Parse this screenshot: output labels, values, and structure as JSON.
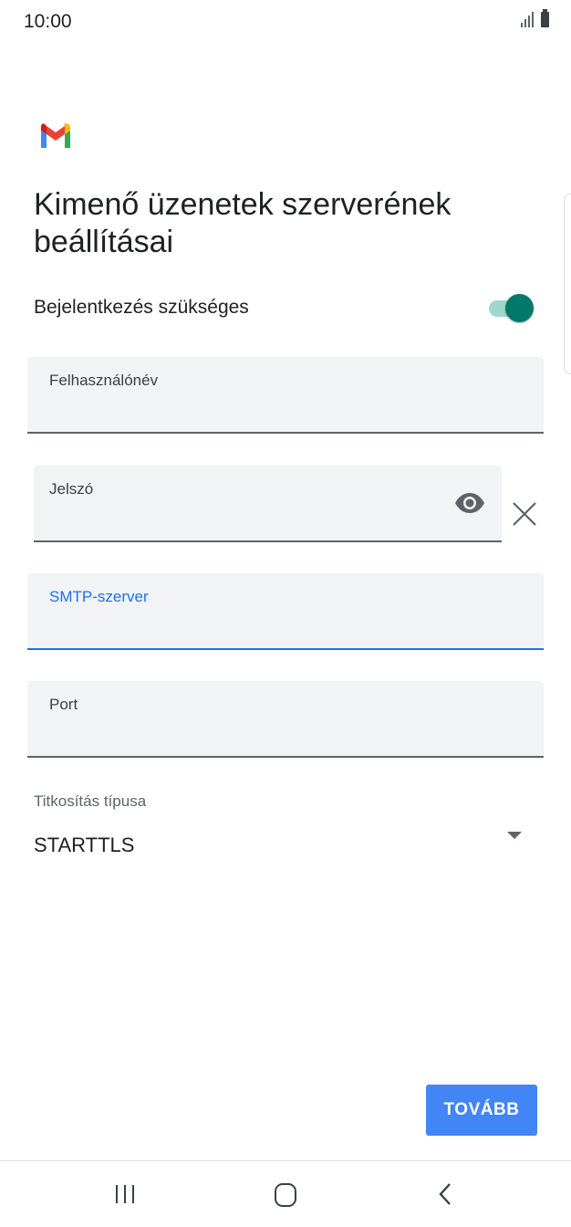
{
  "status_bar": {
    "time": "10:00",
    "icons": [
      "signal-icon",
      "battery-icon"
    ]
  },
  "app": {
    "logo": "gmail-logo",
    "title": "Kimenő üzenetek szerverének beállításai"
  },
  "login_toggle": {
    "label": "Bejelentkezés szükséges",
    "on": true,
    "color": "#00796b"
  },
  "fields": {
    "username": {
      "label": "Felhasználónév",
      "value": ""
    },
    "password": {
      "label": "Jelszó",
      "value": ""
    },
    "smtp": {
      "label": "SMTP-szerver",
      "value": "",
      "focused": true
    },
    "port": {
      "label": "Port",
      "value": ""
    }
  },
  "encryption": {
    "label": "Titkosítás típusa",
    "value": "STARTTLS"
  },
  "actions": {
    "next_label": "TOVÁBB"
  },
  "colors": {
    "accent": "#1a73e8",
    "button": "#4285f4",
    "field_bg": "#f1f3f4"
  },
  "nav_bar": {
    "icons": [
      "recent-apps-icon",
      "home-icon",
      "back-icon"
    ]
  }
}
